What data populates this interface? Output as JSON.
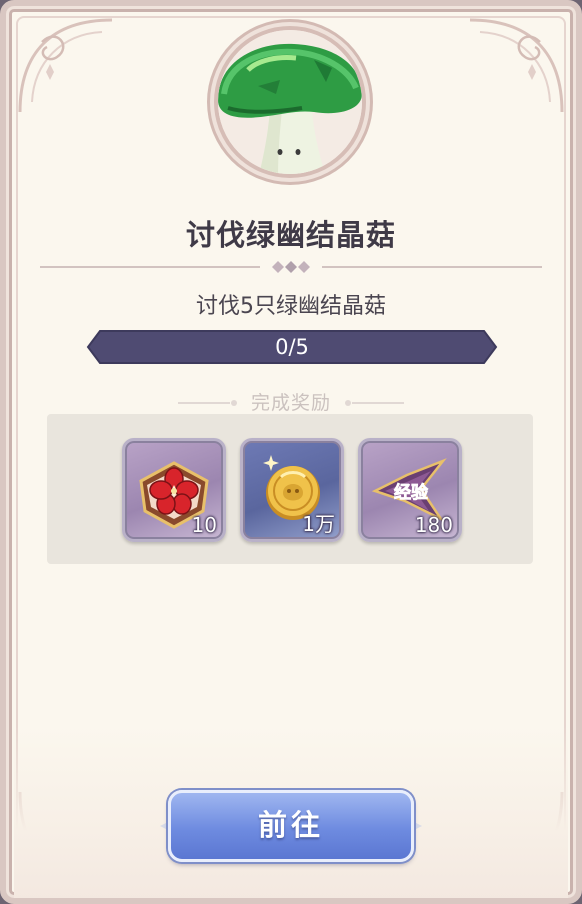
{
  "quest": {
    "title": "讨伐绿幽结晶菇",
    "objective": "讨伐5只绿幽结晶菇",
    "progress_text": "0/5",
    "progress_fraction": 0
  },
  "rewards": {
    "label": "完成奖励",
    "items": [
      {
        "icon": "sakura-emblem-icon",
        "quantity": "10"
      },
      {
        "icon": "gold-coin-icon",
        "quantity": "1万"
      },
      {
        "icon": "experience-icon",
        "quantity": "180",
        "badge_text": "经验"
      }
    ]
  },
  "action": {
    "go_label": "前往"
  },
  "colors": {
    "background": "#fbf7ee",
    "progress_bar": "#4f4b72",
    "button": "#6e8be0",
    "title": "#3f3a47"
  }
}
